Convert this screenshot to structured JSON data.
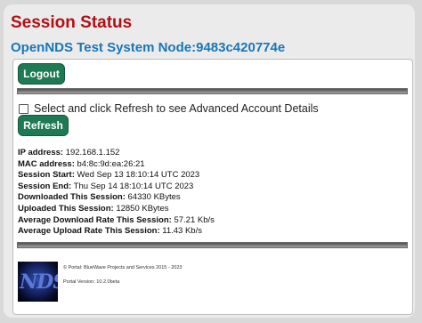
{
  "header": {
    "title": "Session Status",
    "subtitle": "OpenNDS Test System Node:9483c420774e"
  },
  "actions": {
    "logout_label": "Logout",
    "refresh_label": "Refresh",
    "advanced_checkbox_label": "Select and click Refresh to see Advanced Account Details"
  },
  "session": {
    "ip_label": "IP address:",
    "ip_value": "192.168.1.152",
    "mac_label": "MAC address:",
    "mac_value": "b4:8c:9d:ea:26:21",
    "start_label": "Session Start:",
    "start_value": "Wed Sep 13 18:10:14 UTC 2023",
    "end_label": "Session End:",
    "end_value": "Thu Sep 14 18:10:14 UTC 2023",
    "downloaded_label": "Downloaded This Session:",
    "downloaded_value": "64330 KBytes",
    "uploaded_label": "Uploaded This Session:",
    "uploaded_value": "12850 KBytes",
    "avg_down_label": "Average Download Rate This Session:",
    "avg_down_value": "57.21 Kb/s",
    "avg_up_label": "Average Upload Rate This Session:",
    "avg_up_value": "11.43 Kb/s"
  },
  "footer": {
    "logo_text": "NDS",
    "copyright": "© Portal: BlueWave Projects and Services 2015 - 2023",
    "version": "Portal Version: 10.2.0beta"
  },
  "colors": {
    "title": "#b40f16",
    "subtitle": "#1976b7",
    "button": "#1e7a54"
  }
}
